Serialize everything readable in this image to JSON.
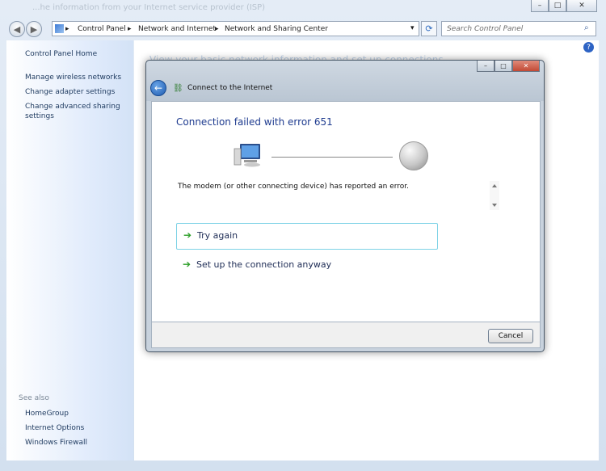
{
  "window": {
    "blurred_title": "...he information from your Internet service provider (ISP)",
    "minimize": "–",
    "maximize": "□",
    "close": "✕"
  },
  "address": {
    "crumbs": [
      "Control Panel",
      "Network and Internet",
      "Network and Sharing Center"
    ],
    "separator": "▸",
    "dropdown": "▾",
    "refresh": "⟳"
  },
  "search": {
    "placeholder": "Search Control Panel",
    "icon": "search-icon"
  },
  "sidebar": {
    "home": "Control Panel Home",
    "links": [
      "Manage wireless networks",
      "Change adapter settings",
      "Change advanced sharing",
      "settings"
    ],
    "see_also_label": "See also",
    "see_also": [
      "HomeGroup",
      "Internet Options",
      "Windows Firewall"
    ]
  },
  "content": {
    "ghost_heading": "View your basic network information and set up connections"
  },
  "dialog": {
    "title": "Connect to the Internet",
    "heading": "Connection failed with error 651",
    "message": "The modem (or other connecting device) has reported an error.",
    "try_again": "Try again",
    "setup_anyway": "Set up the connection anyway",
    "cancel": "Cancel"
  },
  "colors": {
    "accent": "#1e3b8f",
    "link": "#1e3a5f",
    "arrow": "#2fa02a",
    "focus_border": "#7ed2e6"
  }
}
